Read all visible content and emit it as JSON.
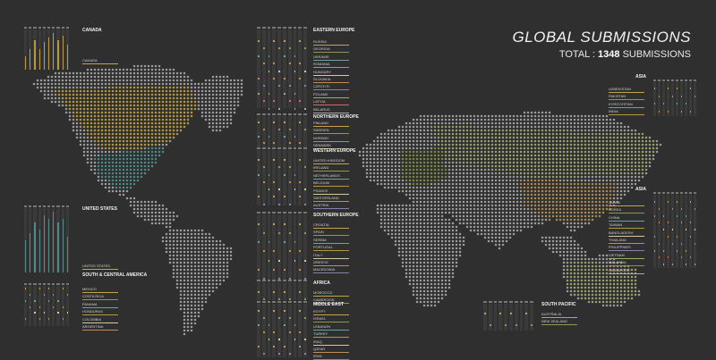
{
  "title": "GLOBAL SUBMISSIONS",
  "total_prefix": "TOTAL :",
  "total_value": "1348",
  "total_suffix": "SUBMISSIONS",
  "colors": {
    "background": "#2f2f2f",
    "neutral_land": "#9c9c9c",
    "canada": "#b8963e",
    "united_states": "#4f8a8a",
    "green_countries": "#9aa070",
    "eastern_europe": "#7a8a4a",
    "china": "#a88a55"
  },
  "chart_data": [
    {
      "type": "bar",
      "region": "CANADA",
      "labels": [
        "CANADA"
      ],
      "series": [
        {
          "values": [
            6,
            9,
            13,
            9,
            12,
            14,
            16,
            13,
            15,
            11
          ]
        }
      ],
      "color": "#b8963e"
    },
    {
      "type": "bar",
      "region": "UNITED STATES",
      "labels": [
        "UNITED STATES"
      ],
      "series": [
        {
          "values": [
            9,
            11,
            14,
            12,
            16,
            15,
            17,
            14,
            15,
            10
          ]
        }
      ],
      "color": "#4f8a8a"
    },
    {
      "type": "bar",
      "region": "SOUTH & CENTRAL AMERICA",
      "labels": [
        "MEXICO",
        "COSTA RICA",
        "PANAMA",
        "HONDURAS",
        "COLOMBIA",
        "ARGENTINA"
      ]
    },
    {
      "type": "bar",
      "region": "EASTERN EUROPE",
      "labels": [
        "RUSSIA",
        "GEORGIA",
        "UKRAINE",
        "ROMANIA",
        "HUNGARY",
        "SLOVAKIA",
        "CZECH R.",
        "POLAND",
        "LATVIA",
        "BELARUS"
      ]
    },
    {
      "type": "bar",
      "region": "NORTHERN EUROPE",
      "labels": [
        "FINLAND",
        "SWEDEN",
        "NORWAY",
        "DENMARK"
      ]
    },
    {
      "type": "bar",
      "region": "WESTERN EUROPE",
      "labels": [
        "UNITED KINGDOM",
        "IRELAND",
        "NETHERLANDS",
        "BELGIUM",
        "FRANCE",
        "SWITZERLAND",
        "AUSTRIA"
      ]
    },
    {
      "type": "bar",
      "region": "SOUTHERN EUROPE",
      "labels": [
        "CROATIA",
        "SPAIN",
        "SERBIA",
        "PORTUGAL",
        "ITALY",
        "GREECE",
        "MACEDONIA"
      ]
    },
    {
      "type": "bar",
      "region": "AFRICA",
      "labels": [
        "MOROCCO",
        "CAMEROON"
      ]
    },
    {
      "type": "bar",
      "region": "MIDDLE EAST",
      "labels": [
        "EGYPT",
        "ISRAEL",
        "LEBANON",
        "TURKEY",
        "IRAQ",
        "QATAR",
        "IRAN"
      ]
    },
    {
      "type": "bar",
      "region": "ASIA",
      "labels": [
        "UZBEKISTAN",
        "PAKISTAN",
        "KYRGYZSTAN",
        "INDIA"
      ]
    },
    {
      "type": "bar",
      "region": "ASIA",
      "labels": [
        "JAPAN",
        "KOREA",
        "CHINA",
        "TAIWAN",
        "BANGLADESH",
        "THAILAND",
        "PHILIPPINES",
        "VIETNAM",
        "MALAYSIA",
        "SINGAPORE"
      ]
    },
    {
      "type": "bar",
      "region": "SOUTH PACIFIC",
      "labels": [
        "AUSTRALIA",
        "NEW ZEALAND"
      ]
    }
  ]
}
